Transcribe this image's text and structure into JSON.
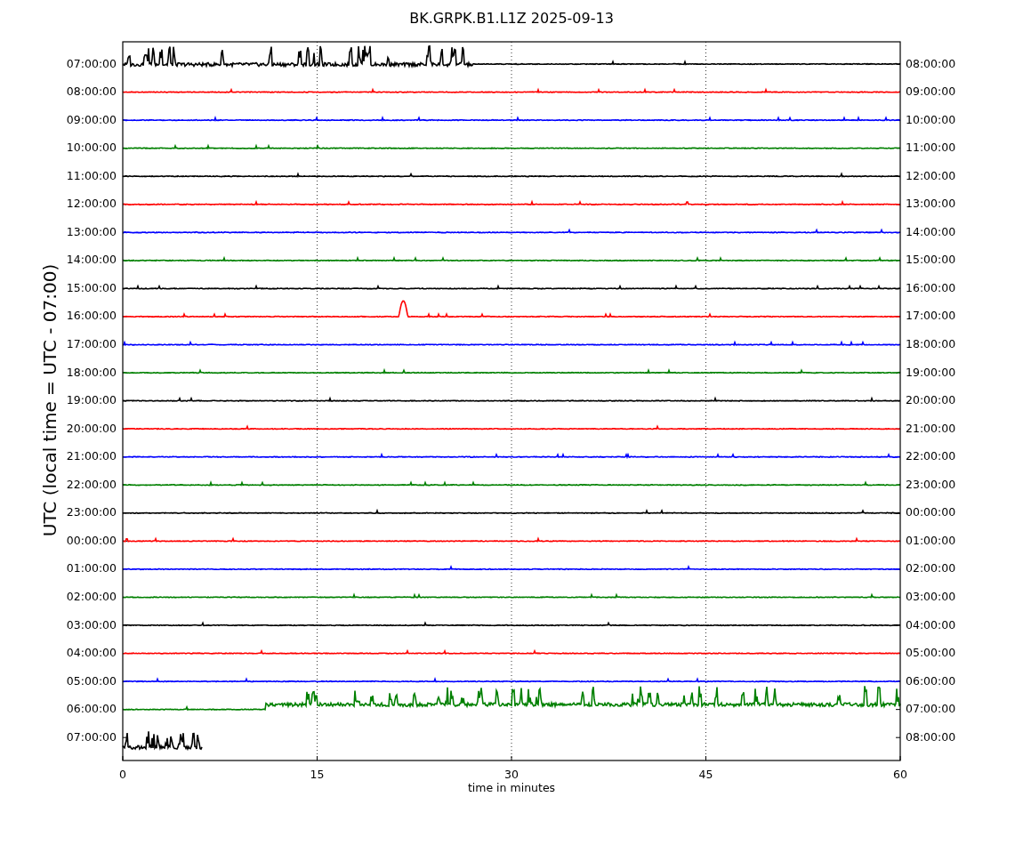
{
  "title": "BK.GRPK.B1.L1Z 2025-09-13",
  "ylabel": "UTC (local time = UTC - 07:00)",
  "xlabel": "time in minutes",
  "xticks": [
    "0",
    "15",
    "30",
    "45",
    "60"
  ],
  "rows": [
    {
      "left": "07:00:00",
      "right": "08:00:00",
      "color": "#000000",
      "kind": "busy_start"
    },
    {
      "left": "08:00:00",
      "right": "09:00:00",
      "color": "#ff0000",
      "kind": "quiet"
    },
    {
      "left": "09:00:00",
      "right": "10:00:00",
      "color": "#0000ff",
      "kind": "quiet"
    },
    {
      "left": "10:00:00",
      "right": "11:00:00",
      "color": "#008000",
      "kind": "quiet"
    },
    {
      "left": "11:00:00",
      "right": "12:00:00",
      "color": "#000000",
      "kind": "quiet"
    },
    {
      "left": "12:00:00",
      "right": "13:00:00",
      "color": "#ff0000",
      "kind": "quiet"
    },
    {
      "left": "13:00:00",
      "right": "14:00:00",
      "color": "#0000ff",
      "kind": "quiet"
    },
    {
      "left": "14:00:00",
      "right": "15:00:00",
      "color": "#008000",
      "kind": "quiet"
    },
    {
      "left": "15:00:00",
      "right": "16:00:00",
      "color": "#000000",
      "kind": "quiet"
    },
    {
      "left": "16:00:00",
      "right": "17:00:00",
      "color": "#ff0000",
      "kind": "spike"
    },
    {
      "left": "17:00:00",
      "right": "18:00:00",
      "color": "#0000ff",
      "kind": "quiet"
    },
    {
      "left": "18:00:00",
      "right": "19:00:00",
      "color": "#008000",
      "kind": "quiet"
    },
    {
      "left": "19:00:00",
      "right": "20:00:00",
      "color": "#000000",
      "kind": "quiet"
    },
    {
      "left": "20:00:00",
      "right": "21:00:00",
      "color": "#ff0000",
      "kind": "quiet"
    },
    {
      "left": "21:00:00",
      "right": "22:00:00",
      "color": "#0000ff",
      "kind": "quiet"
    },
    {
      "left": "22:00:00",
      "right": "23:00:00",
      "color": "#008000",
      "kind": "quiet"
    },
    {
      "left": "23:00:00",
      "right": "00:00:00",
      "color": "#000000",
      "kind": "quiet"
    },
    {
      "left": "00:00:00",
      "right": "01:00:00",
      "color": "#ff0000",
      "kind": "quiet"
    },
    {
      "left": "01:00:00",
      "right": "02:00:00",
      "color": "#0000ff",
      "kind": "quiet"
    },
    {
      "left": "02:00:00",
      "right": "03:00:00",
      "color": "#008000",
      "kind": "quiet"
    },
    {
      "left": "03:00:00",
      "right": "04:00:00",
      "color": "#000000",
      "kind": "quiet"
    },
    {
      "left": "04:00:00",
      "right": "05:00:00",
      "color": "#ff0000",
      "kind": "quiet"
    },
    {
      "left": "05:00:00",
      "right": "06:00:00",
      "color": "#0000ff",
      "kind": "quiet"
    },
    {
      "left": "06:00:00",
      "right": "07:00:00",
      "color": "#008000",
      "kind": "busy_end"
    },
    {
      "left": "07:00:00",
      "right": "08:00:00",
      "color": "#000000",
      "kind": "partial"
    }
  ]
}
